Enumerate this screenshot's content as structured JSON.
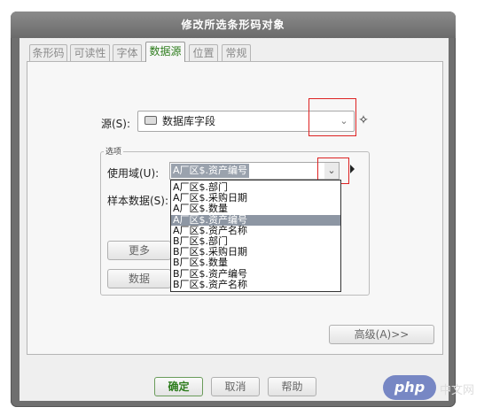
{
  "window": {
    "title": "修改所选条形码对象"
  },
  "tabs": [
    "条形码",
    "可读性",
    "字体",
    "数据源",
    "位置",
    "常规"
  ],
  "source": {
    "label": "源(S):",
    "value": "数据库字段"
  },
  "group": {
    "title": "选项"
  },
  "use_field": {
    "label": "使用域(U):",
    "value": "A厂区$.资产编号"
  },
  "sample": {
    "label": "样本数据(S):"
  },
  "dropdown_items": [
    "A厂区$.部门",
    "A厂区$.采购日期",
    "A厂区$.数量",
    "A厂区$.资产编号",
    "A厂区$.资产名称",
    "B厂区$.部门",
    "B厂区$.采购日期",
    "B厂区$.数量",
    "B厂区$.资产编号",
    "B厂区$.资产名称"
  ],
  "dropdown_selected_index": 3,
  "buttons": {
    "more": "更多",
    "data": "数据",
    "advanced": "高级(A)>>",
    "ok": "确定",
    "cancel": "取消",
    "help": "帮助"
  },
  "watermark": {
    "logo": "php",
    "text": "中文网"
  },
  "colors": {
    "frame": "#6f6f6f",
    "accent_green": "#2e7d1d",
    "highlight": "#d22222"
  }
}
